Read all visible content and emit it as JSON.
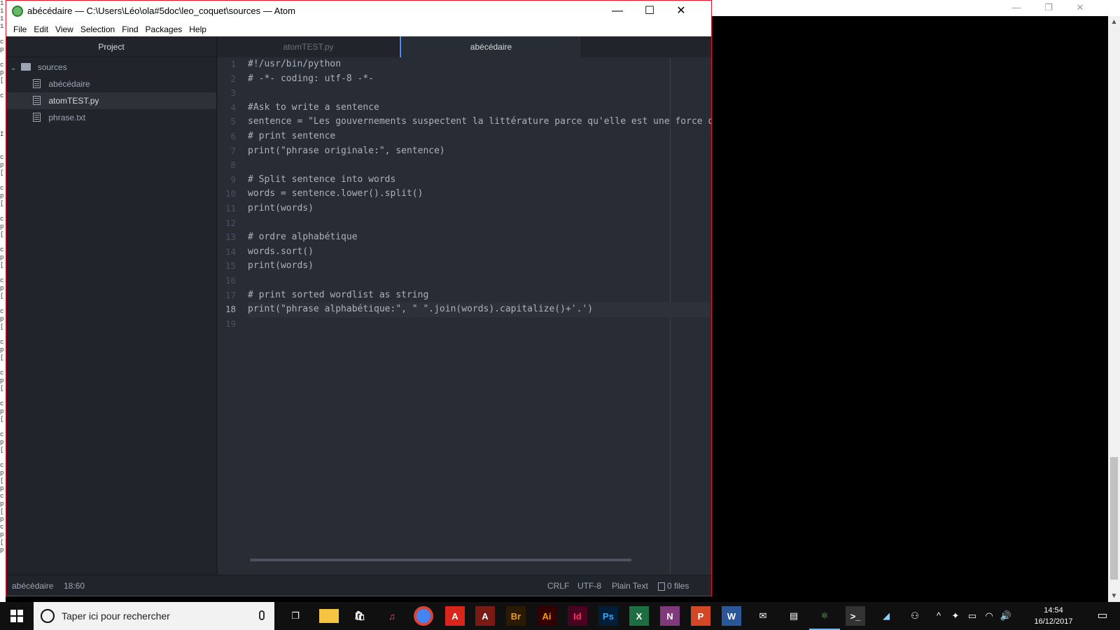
{
  "left_sliver_chars": [
    "1",
    "1",
    "1",
    "1",
    "",
    "c",
    "p",
    "",
    "c",
    "p",
    "[",
    "",
    "c",
    "",
    "",
    "",
    "",
    "I",
    "",
    "",
    "c",
    "p",
    "[",
    "",
    "c",
    "p",
    "[",
    "",
    "c",
    "p",
    "[",
    "",
    "c",
    "p",
    "[",
    "",
    "c",
    "p",
    "[",
    "",
    "c",
    "p",
    "[",
    "",
    "c",
    "p",
    "[",
    "",
    "c",
    "p",
    "[",
    "",
    "c",
    "p",
    "[",
    "",
    "c",
    "p",
    "[",
    "",
    "c",
    "p",
    "[",
    "p",
    "c",
    "p",
    "[",
    "p",
    "c",
    "p",
    "[",
    "p"
  ],
  "atom": {
    "title": "abécédaire — C:\\Users\\Léo\\ola#5doc\\leo_coquet\\sources — Atom",
    "window_controls": {
      "minimize": "—",
      "maximize": "☐",
      "close": "✕"
    },
    "menu": [
      "File",
      "Edit",
      "View",
      "Selection",
      "Find",
      "Packages",
      "Help"
    ],
    "tree": {
      "header": "Project",
      "folder": "sources",
      "files": [
        "abécédaire",
        "atomTEST.py",
        "phrase.txt"
      ]
    },
    "tabs": [
      "atomTEST.py",
      "abécédaire"
    ],
    "editor": {
      "line_numbers": [
        "1",
        "2",
        "3",
        "4",
        "5",
        "6",
        "7",
        "8",
        "9",
        "10",
        "11",
        "12",
        "13",
        "14",
        "15",
        "16",
        "17",
        "18",
        "19"
      ],
      "lines": [
        "#!/usr/bin/python",
        "# -*- coding: utf-8 -*-",
        "",
        "#Ask to write a sentence",
        "sentence = \"Les gouvernements suspectent la littérature parce qu'elle est une force qui",
        "# print sentence",
        "print(\"phrase originale:\", sentence)",
        "",
        "# Split sentence into words",
        "words = sentence.lower().split()",
        "print(words)",
        "",
        "# ordre alphabétique",
        "words.sort()",
        "print(words)",
        "",
        "# print sorted wordlist as string",
        "print(\"phrase alphabétique:\", \" \".join(words).capitalize()+'.')",
        ""
      ]
    },
    "statusbar": {
      "file": "abécédaire",
      "cursor": "18:60",
      "line_ending": "CRLF",
      "encoding": "UTF-8",
      "grammar": "Plain Text",
      "git_files": "0 files"
    }
  },
  "taskbar": {
    "search_placeholder": "Taper ici pour rechercher",
    "apps": [
      {
        "icon": "task-view-icon",
        "label": "❐",
        "color": "#ffffff",
        "bg": "transparent"
      },
      {
        "icon": "file-explorer-icon",
        "label": "",
        "color": "#f6c342",
        "bg": "#f6c342"
      },
      {
        "icon": "store-icon",
        "label": "🛍",
        "color": "#ffffff",
        "bg": "transparent"
      },
      {
        "icon": "itunes-icon",
        "label": "♫",
        "color": "#e64f8d",
        "bg": "transparent"
      },
      {
        "icon": "chrome-icon",
        "label": "",
        "color": "#4285f4",
        "bg": "#4285f4"
      },
      {
        "icon": "acrobat-icon",
        "label": "A",
        "color": "#ffffff",
        "bg": "#d9261c"
      },
      {
        "icon": "acrobat-reader-icon",
        "label": "A",
        "color": "#ffffff",
        "bg": "#7a1a14"
      },
      {
        "icon": "bridge-icon",
        "label": "Br",
        "color": "#e89c27",
        "bg": "#2a1a00"
      },
      {
        "icon": "illustrator-icon",
        "label": "Ai",
        "color": "#ff9a00",
        "bg": "#330000"
      },
      {
        "icon": "indesign-icon",
        "label": "Id",
        "color": "#ff3366",
        "bg": "#49021f"
      },
      {
        "icon": "photoshop-icon",
        "label": "Ps",
        "color": "#31a8ff",
        "bg": "#001e36"
      },
      {
        "icon": "excel-icon",
        "label": "X",
        "color": "#ffffff",
        "bg": "#1d6f42"
      },
      {
        "icon": "onenote-icon",
        "label": "N",
        "color": "#ffffff",
        "bg": "#80397b"
      },
      {
        "icon": "powerpoint-icon",
        "label": "P",
        "color": "#ffffff",
        "bg": "#d24726"
      },
      {
        "icon": "word-icon",
        "label": "W",
        "color": "#ffffff",
        "bg": "#2b579a"
      },
      {
        "icon": "mail-icon",
        "label": "✉",
        "color": "#ffffff",
        "bg": "transparent"
      },
      {
        "icon": "news-icon",
        "label": "▤",
        "color": "#ffffff",
        "bg": "transparent"
      },
      {
        "icon": "atom-icon",
        "label": "⚛",
        "color": "#66bb6a",
        "bg": "transparent"
      },
      {
        "icon": "terminal-icon",
        "label": ">_",
        "color": "#ffffff",
        "bg": "#333333"
      },
      {
        "icon": "notes-icon",
        "label": "◢",
        "color": "#8fd3ff",
        "bg": "transparent"
      }
    ],
    "tray": [
      "⚇",
      "^",
      "✦",
      "▭",
      "◠",
      "🔊"
    ],
    "time": "14:54",
    "date": "16/12/2017",
    "notifications": "▭"
  },
  "bg_window_controls": {
    "minimize": "—",
    "maximize": "❐",
    "close": "✕"
  }
}
